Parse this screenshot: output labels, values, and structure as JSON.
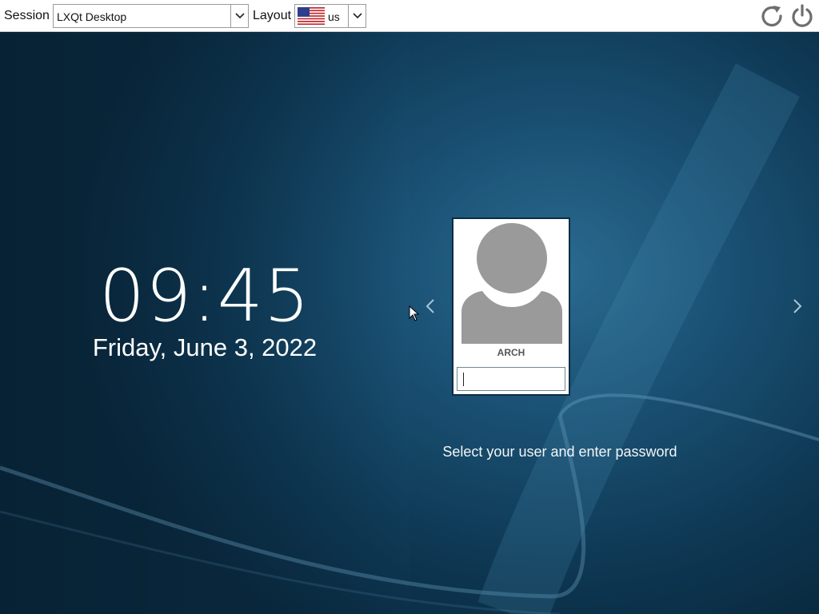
{
  "topbar": {
    "session_label": "Session",
    "session_value": "LXQt Desktop",
    "layout_label": "Layout",
    "layout_value": "us",
    "layout_flag_icon": "us-flag-icon",
    "reboot_icon": "reboot-icon",
    "shutdown_icon": "shutdown-icon"
  },
  "clock": {
    "time": "09:45",
    "date": "Friday, June 3, 2022"
  },
  "user_card": {
    "username": "ARCH",
    "password_value": "",
    "avatar_icon": "user-avatar-icon"
  },
  "status_message": "Select your user and enter password",
  "nav": {
    "prev_icon": "chevron-left-icon",
    "next_icon": "chevron-right-icon"
  },
  "colors": {
    "background": "#1b5478",
    "topbar": "#ffffff",
    "avatar": "#9a9a9a",
    "card_border": "#0c2c42"
  }
}
